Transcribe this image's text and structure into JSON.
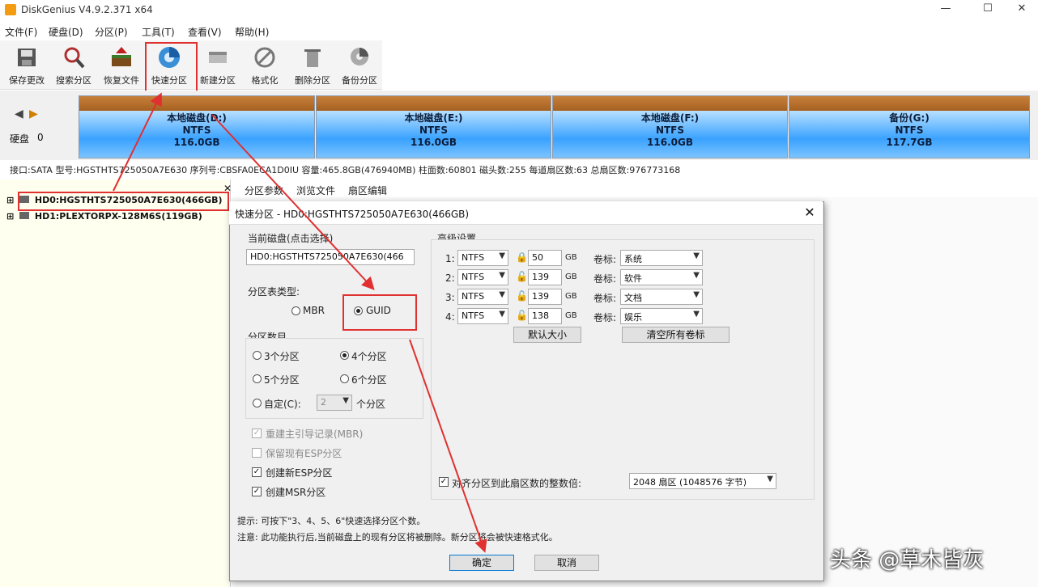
{
  "window": {
    "title": "DiskGenius V4.9.2.371 x64",
    "controls": {
      "minimize": "—",
      "maximize": "☐",
      "close": "✕"
    }
  },
  "menu": [
    "文件(F)",
    "硬盘(D)",
    "分区(P)",
    "工具(T)",
    "查看(V)",
    "帮助(H)"
  ],
  "toolbar": [
    {
      "label": "保存更改",
      "icon": "save-icon"
    },
    {
      "label": "搜索分区",
      "icon": "search-icon"
    },
    {
      "label": "恢复文件",
      "icon": "recover-icon"
    },
    {
      "label": "快速分区",
      "icon": "quick-partition-icon"
    },
    {
      "label": "新建分区",
      "icon": "new-partition-icon"
    },
    {
      "label": "格式化",
      "icon": "format-icon"
    },
    {
      "label": "删除分区",
      "icon": "delete-icon"
    },
    {
      "label": "备份分区",
      "icon": "backup-icon"
    }
  ],
  "disk_nav": {
    "label": "硬盘",
    "index": "0"
  },
  "partitions": [
    {
      "name": "本地磁盘(D:)",
      "fs": "NTFS",
      "size": "116.0GB"
    },
    {
      "name": "本地磁盘(E:)",
      "fs": "NTFS",
      "size": "116.0GB"
    },
    {
      "name": "本地磁盘(F:)",
      "fs": "NTFS",
      "size": "116.0GB"
    },
    {
      "name": "备份(G:)",
      "fs": "NTFS",
      "size": "117.7GB"
    }
  ],
  "disk_info": "接口:SATA  型号:HGSTHTS725050A7E630  序列号:CBSFA0ECA1D0IU  容量:465.8GB(476940MB)  柱面数:60801  磁头数:255  每道扇区数:63  总扇区数:976773168",
  "tree": [
    {
      "label": "HD0:HGSTHTS725050A7E630(466GB)"
    },
    {
      "label": "HD1:PLEXTORPX-128M6S(119GB)"
    }
  ],
  "right_tabs": [
    "分区参数",
    "浏览文件",
    "扇区编辑"
  ],
  "dialog": {
    "title": "快速分区 - HD0:HGSTHTS725050A7E630(466GB)",
    "close": "✕",
    "current_disk_label": "当前磁盘(点击选择)",
    "current_disk_value": "HD0:HGSTHTS725050A7E630(466",
    "table_type_label": "分区表类型:",
    "mbr": "MBR",
    "guid": "GUID",
    "count_label": "分区数目",
    "counts": {
      "c3": "3个分区",
      "c4": "4个分区",
      "c5": "5个分区",
      "c6": "6个分区"
    },
    "custom": "自定(C):",
    "custom_value": "2",
    "custom_suffix": "个分区",
    "checks": {
      "rebuild_mbr": "重建主引导记录(MBR)",
      "keep_esp": "保留现有ESP分区",
      "create_esp": "创建新ESP分区",
      "create_msr": "创建MSR分区"
    },
    "advanced_label": "高级设置",
    "rows": [
      {
        "n": "1:",
        "fs": "NTFS",
        "size": "50",
        "unit": "GB",
        "vol_label": "卷标:",
        "vol": "系统"
      },
      {
        "n": "2:",
        "fs": "NTFS",
        "size": "139",
        "unit": "GB",
        "vol_label": "卷标:",
        "vol": "软件"
      },
      {
        "n": "3:",
        "fs": "NTFS",
        "size": "139",
        "unit": "GB",
        "vol_label": "卷标:",
        "vol": "文档"
      },
      {
        "n": "4:",
        "fs": "NTFS",
        "size": "138",
        "unit": "GB",
        "vol_label": "卷标:",
        "vol": "娱乐"
      }
    ],
    "default_size": "默认大小",
    "clear_labels": "清空所有卷标",
    "align_label": "对齐分区到此扇区数的整数倍:",
    "align_value": "2048 扇区 (1048576 字节)",
    "tip1": "提示:  可按下\"3、4、5、6\"快速选择分区个数。",
    "tip2": "注意:  此功能执行后,当前磁盘上的现有分区将被删除。新分区将会被快速格式化。",
    "ok": "确定",
    "cancel": "取消"
  },
  "watermark": "头条 @草木皆灰",
  "colors": {
    "highlight": "#e03030",
    "partition_blue": "#3aa2ff",
    "partition_head": "#b06a28"
  }
}
